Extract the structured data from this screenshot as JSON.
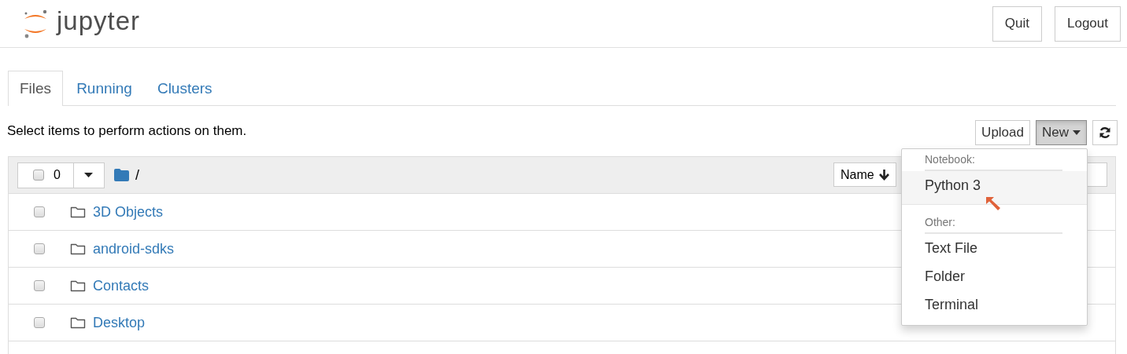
{
  "header": {
    "logo_text": "jupyter",
    "buttons": [
      "Quit",
      "Logout"
    ]
  },
  "tabs": [
    {
      "label": "Files",
      "selected": true
    },
    {
      "label": "Running",
      "selected": false
    },
    {
      "label": "Clusters",
      "selected": false
    }
  ],
  "toolbar": {
    "hint": "Select items to perform actions on them.",
    "buttons": [
      {
        "kind": "text",
        "label": "Upload",
        "active": false
      },
      {
        "kind": "dropdown",
        "label": "New",
        "active": true
      },
      {
        "kind": "refresh",
        "active": false
      }
    ]
  },
  "listing": {
    "select_all_checked": false,
    "selected_count": "0",
    "path": "/",
    "sort_button": "Name",
    "rows": [
      {
        "name": "3D Objects",
        "checked": false
      },
      {
        "name": "android-sdks",
        "checked": false
      },
      {
        "name": "Contacts",
        "checked": false
      },
      {
        "name": "Desktop",
        "checked": false
      }
    ]
  },
  "new_menu": {
    "sections": [
      {
        "header": "Notebook:",
        "items": [
          {
            "label": "Python 3",
            "hovered": true
          }
        ]
      },
      {
        "header": "Other:",
        "items": [
          {
            "label": "Text File",
            "hovered": false
          },
          {
            "label": "Folder",
            "hovered": false
          },
          {
            "label": "Terminal",
            "hovered": false
          }
        ]
      }
    ]
  }
}
